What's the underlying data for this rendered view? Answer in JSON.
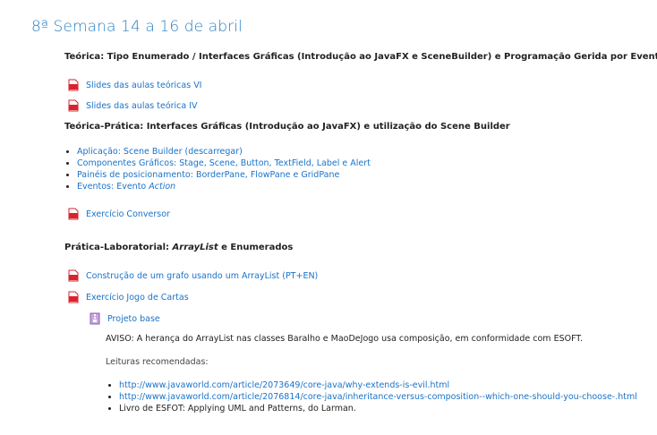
{
  "section": {
    "title": "8ª Semana 14 a 16 de abril"
  },
  "teorica": {
    "label": "Teórica",
    "text": ": Tipo Enumerado / Interfaces Gráficas (Introdução ao JavaFX e SceneBuilder) e Programação Gerida por Eventos",
    "resources": [
      {
        "label": "Slides das aulas teóricas VI",
        "icon": "pdf-icon"
      },
      {
        "label": "Slides das aulas teórica IV",
        "icon": "pdf-icon"
      }
    ]
  },
  "teorico_pratica": {
    "label": "Teórica-Prática",
    "text": ": Interfaces Gráficas (Introdução ao JavaFX) e utilização do Scene Builder",
    "items": [
      {
        "text": "Aplicação: Scene Builder (descarregar)"
      },
      {
        "text": "Componentes Gráficos: Stage, Scene, Button, TextField, Label e Alert"
      },
      {
        "text": "Painéis de posicionamento: BorderPane, FlowPane e GridPane"
      },
      {
        "prefix": "Eventos: Evento ",
        "emph": "Action"
      }
    ],
    "resource": {
      "label": "Exercício Conversor",
      "icon": "pdf-icon"
    }
  },
  "pratica": {
    "label": "Prática-Laboratorial: ",
    "emph": "ArrayList",
    "suffix": " e Enumerados",
    "resources": [
      {
        "label": "Construção de um grafo usando um ArrayList (PT+EN)",
        "icon": "pdf-icon"
      },
      {
        "label": "Exercício Jogo de Cartas",
        "icon": "pdf-icon"
      }
    ],
    "sub_resource": {
      "label": "Projeto base",
      "icon": "archive-icon"
    },
    "aviso": "AVISO: A herança do ArrayList nas classes Baralho e MaoDeJogo usa composição, em conformidade com ESOFT.",
    "leituras_label": "Leituras recomendadas:",
    "leituras": [
      "http://www.javaworld.com/article/2073649/core-java/why-extends-is-evil.html",
      "http://www.javaworld.com/article/2076814/core-java/inheritance-versus-composition--which-one-should-you-choose-.html",
      "Livro de ESFOT: Applying UML and Patterns, do Larman."
    ]
  },
  "colors": {
    "link": "#1a73c8",
    "title": "#2a7fc4",
    "pdf": "#d9232d"
  }
}
